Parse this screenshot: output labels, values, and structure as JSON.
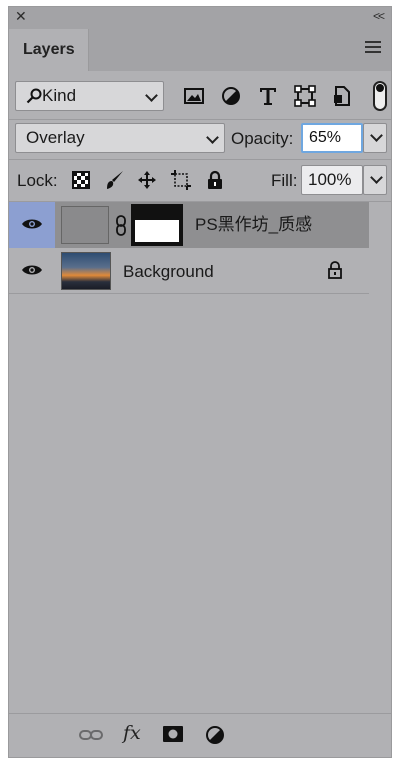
{
  "panel": {
    "close_glyph": "✕",
    "collapse_glyph": "<<",
    "tab_label": "Layers",
    "menu_icon": "hamburger-menu-icon"
  },
  "filter": {
    "kind_label": "Kind",
    "icons": [
      "image-filter-icon",
      "adjustment-filter-icon",
      "type-filter-icon",
      "shape-filter-icon",
      "smart-object-filter-icon"
    ],
    "toggle_icon": "filter-toggle-icon"
  },
  "blend": {
    "mode_label": "Overlay",
    "opacity_label": "Opacity:",
    "opacity_value": "65%"
  },
  "lock": {
    "label": "Lock:",
    "icons": [
      "lock-transparent-pixels-icon",
      "lock-image-pixels-icon",
      "lock-position-icon",
      "lock-artboard-icon",
      "lock-all-icon"
    ],
    "fill_label": "Fill:",
    "fill_value": "100%"
  },
  "layers": [
    {
      "name": "PS黑作坊_质感",
      "visible": true,
      "selected": true,
      "has_mask": true,
      "linked": true
    },
    {
      "name": "Background",
      "visible": true,
      "selected": false,
      "locked": true
    }
  ],
  "bottom": {
    "icons": [
      "link-layers-icon",
      "fx-icon",
      "add-mask-icon",
      "new-adjustment-layer-icon"
    ],
    "fx_label": "fx"
  },
  "colors": {
    "panel_bg": "#b1b1b4",
    "header_bg": "#a3a3a6",
    "selected_row": "#8f8f91",
    "eye_selected_bg": "#8c9fd1",
    "input_focus": "#6fa7e0"
  }
}
